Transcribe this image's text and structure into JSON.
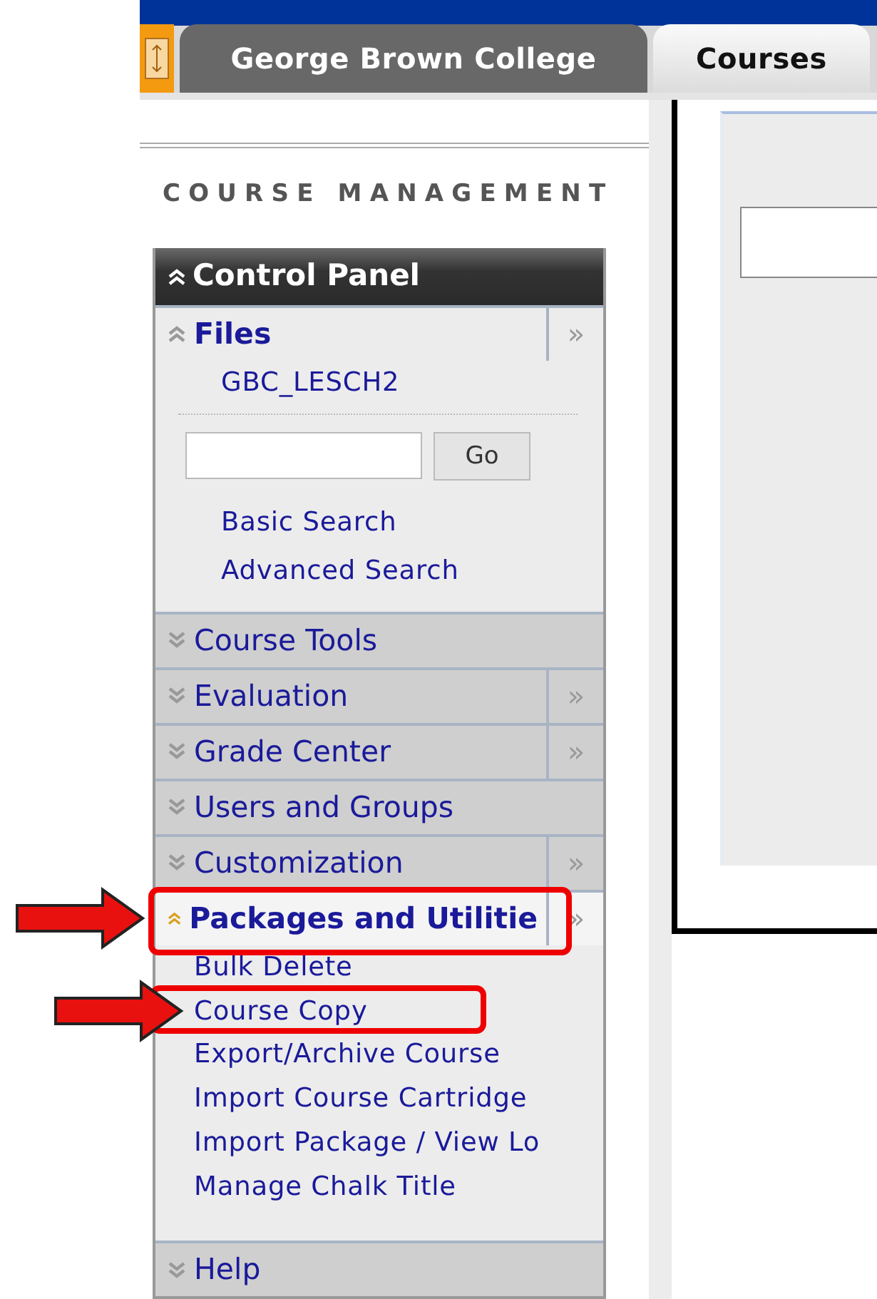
{
  "tabs": [
    {
      "label": "George Brown College",
      "selected": false
    },
    {
      "label": "Courses",
      "selected": true
    }
  ],
  "heading": "COURSE MANAGEMENT",
  "panel": {
    "title": "Control Panel",
    "sections": [
      {
        "title": "Files",
        "expanded": true,
        "selected": false,
        "highlighted": false,
        "menu": "»",
        "kind": "files",
        "folder": "GBC_LESCH2",
        "go": "Go",
        "links": [
          "Basic Search",
          "Advanced Search"
        ]
      },
      {
        "title": "Course Tools",
        "expanded": false,
        "selected": false,
        "highlighted": false
      },
      {
        "title": "Evaluation",
        "expanded": false,
        "selected": false,
        "highlighted": false,
        "menu": "»"
      },
      {
        "title": "Grade Center",
        "expanded": false,
        "selected": false,
        "highlighted": false,
        "menu": "»"
      },
      {
        "title": "Users and Groups",
        "expanded": false,
        "selected": false,
        "highlighted": false
      },
      {
        "title": "Customization",
        "expanded": false,
        "selected": false,
        "highlighted": false,
        "menu": "»"
      },
      {
        "title": "Packages and Utilitie",
        "expanded": true,
        "selected": true,
        "highlighted": true,
        "menu": "»",
        "kind": "links",
        "items": [
          {
            "label": "Bulk Delete",
            "highlighted": false
          },
          {
            "label": "Course Copy",
            "highlighted": true
          },
          {
            "label": "Export/Archive Course",
            "highlighted": false
          },
          {
            "label": "Import Course Cartridge",
            "highlighted": false
          },
          {
            "label": "Import Package / View Lo",
            "highlighted": false
          },
          {
            "label": "Manage Chalk Title",
            "highlighted": false
          }
        ]
      },
      {
        "title": "Help",
        "expanded": false,
        "selected": false,
        "highlighted": false
      }
    ]
  }
}
